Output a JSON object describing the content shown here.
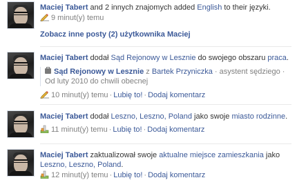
{
  "stories": [
    {
      "actor": "Maciej Tabert",
      "text_before": " and 2 innych znajomych added ",
      "object": "English",
      "text_after": " to their języki.",
      "time": "9 minut(y) temu"
    },
    {
      "more_posts_label": "Zobacz inne posty (2) użytkownika Maciej"
    },
    {
      "actor": "Maciej Tabert",
      "text_before": " dodał ",
      "object": "Sąd Rejonowy w Lesznie",
      "text_middle": " do swojego obszaru ",
      "object2": "praca",
      "text_after": ".",
      "attachment": {
        "title": "Sąd Rejonowy w Lesznie",
        "with_prefix": " z ",
        "with_person": "Bartek Przyniczka",
        "role": " · asystent sędziego ·",
        "dates": "Od luty 2010 do chwili obecnej"
      },
      "time": "10 minut(y) temu",
      "like": "Lubię to!",
      "comment": "Dodaj komentarz",
      "separator": "·"
    },
    {
      "actor": "Maciej Tabert",
      "text_before": " dodał ",
      "object": "Leszno, Leszno, Poland",
      "text_middle": " jako swoje ",
      "object2": "miasto rodzinne",
      "text_after": ".",
      "time": "11 minut(y) temu",
      "like": "Lubię to!",
      "comment": "Dodaj komentarz",
      "separator": "·"
    },
    {
      "actor": "Maciej Tabert",
      "text_before": " zaktualizował swoje ",
      "object": "aktualne miejsce zamieszkania",
      "text_middle": " jako ",
      "object2": "Leszno, Leszno, Poland",
      "text_after": ".",
      "time": "12 minut(y) temu",
      "like": "Lubię to!",
      "comment": "Dodaj komentarz",
      "separator": "·"
    }
  ],
  "icons": {
    "pencil": "pencil-icon",
    "place": "place-pin-icon",
    "briefcase": "briefcase-icon"
  },
  "colors": {
    "link": "#3b5998",
    "meta": "#808080",
    "text": "#333333"
  }
}
